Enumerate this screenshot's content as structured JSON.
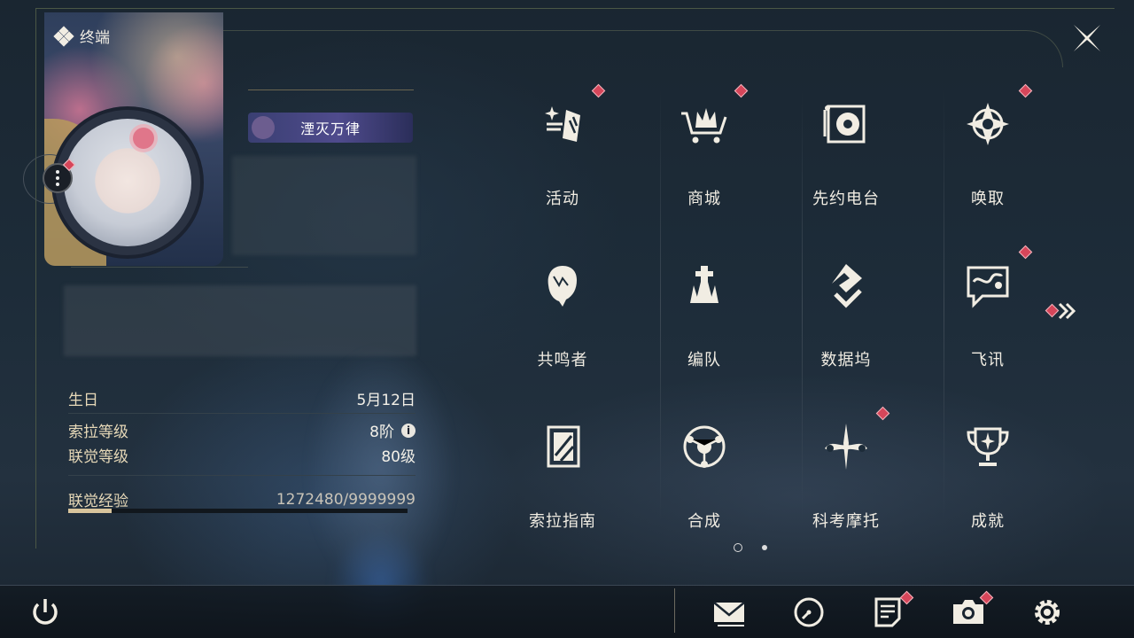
{
  "terminal": {
    "title": "终端"
  },
  "profile": {
    "title_badge": "湮灭万律",
    "stats": [
      {
        "label": "生日",
        "value": "5月12日"
      },
      {
        "label": "索拉等级",
        "value": "8阶",
        "info": "i"
      },
      {
        "label": "联觉等级",
        "value": "80级"
      },
      {
        "label": "联觉经验",
        "value": "1272480/9999999"
      }
    ],
    "experience": {
      "current": 1272480,
      "max": 9999999,
      "fraction": 0.127
    }
  },
  "menu": {
    "items": [
      {
        "label": "活动",
        "icon": "sparkle-icon",
        "badge": true
      },
      {
        "label": "商城",
        "icon": "cart-icon",
        "badge": true
      },
      {
        "label": "先约电台",
        "icon": "radio-icon",
        "badge": false
      },
      {
        "label": "唤取",
        "icon": "compass-star-icon",
        "badge": true
      },
      {
        "label": "共鸣者",
        "icon": "resonator-head-icon",
        "badge": false
      },
      {
        "label": "编队",
        "icon": "chess-team-icon",
        "badge": false
      },
      {
        "label": "数据坞",
        "icon": "databank-icon",
        "badge": false
      },
      {
        "label": "飞讯",
        "icon": "message-icon",
        "badge": true
      },
      {
        "label": "索拉指南",
        "icon": "guidebook-icon",
        "badge": false
      },
      {
        "label": "合成",
        "icon": "synthesis-icon",
        "badge": false
      },
      {
        "label": "科考摩托",
        "icon": "motorbike-icon",
        "badge": true
      },
      {
        "label": "成就",
        "icon": "trophy-icon",
        "badge": false
      }
    ],
    "page_count": 2,
    "current_page": 1
  },
  "bottom_bar": {
    "buttons": [
      "power-icon",
      "mail-icon",
      "clock-icon",
      "notes-icon",
      "camera-icon",
      "settings-icon"
    ]
  },
  "colors": {
    "accent_red": "#d6465a",
    "gold": "#d8c49c"
  }
}
